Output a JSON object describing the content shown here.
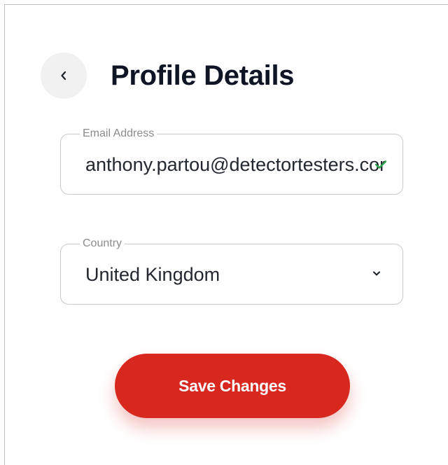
{
  "header": {
    "back_icon": "chevron-left-icon",
    "title": "Profile Details"
  },
  "form": {
    "email": {
      "label": "Email Address",
      "value": "anthony.partou@detectortesters.cor",
      "status_icon": "check-icon",
      "status_color": "#2ea44f"
    },
    "country": {
      "label": "Country",
      "value": "United Kingdom",
      "dropdown_icon": "chevron-down-icon"
    }
  },
  "actions": {
    "save_label": "Save Changes",
    "save_color": "#d7271f"
  }
}
